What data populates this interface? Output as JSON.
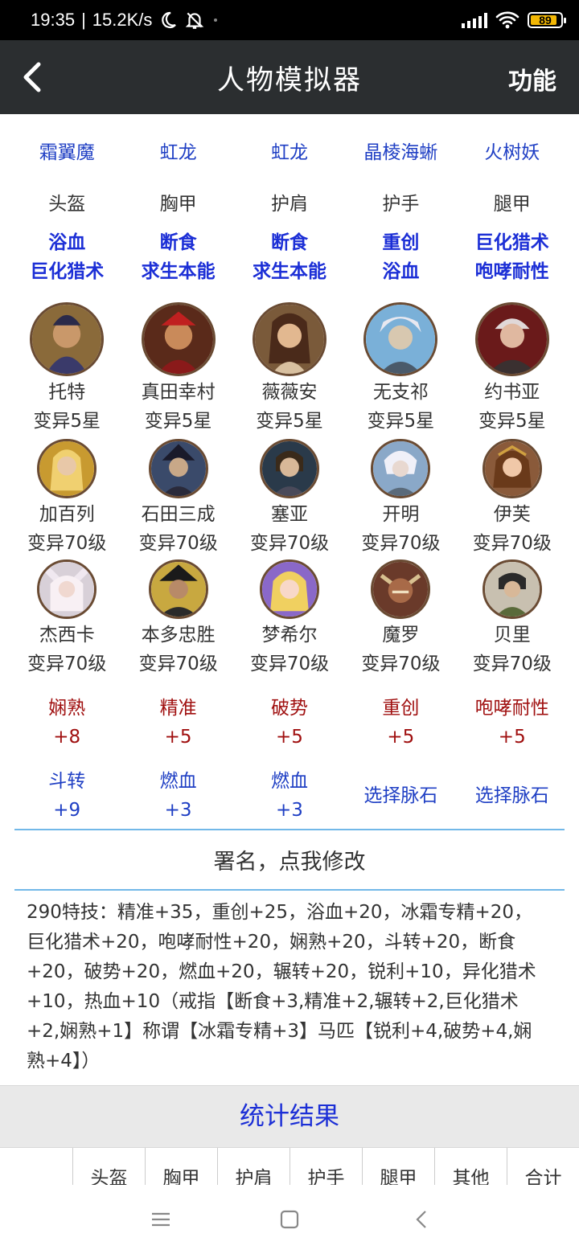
{
  "status_bar": {
    "time": "19:35",
    "separator": "|",
    "net_speed": "15.2K/s",
    "battery": "89",
    "battery_level": 0.89
  },
  "app_bar": {
    "title": "人物模拟器",
    "right_action": "功能"
  },
  "equipment": {
    "monsters": [
      "霜翼魔",
      "虹龙",
      "虹龙",
      "晶棱海蜥",
      "火树妖"
    ],
    "slots": [
      "头盔",
      "胸甲",
      "护肩",
      "护手",
      "腿甲"
    ],
    "skills": [
      [
        "浴血",
        "巨化猎术"
      ],
      [
        "断食",
        "求生本能"
      ],
      [
        "断食",
        "求生本能"
      ],
      [
        "重创",
        "浴血"
      ],
      [
        "巨化猎术",
        "咆哮耐性"
      ]
    ]
  },
  "heroes": [
    [
      {
        "name": "托特",
        "level": "变异5星"
      },
      {
        "name": "真田幸村",
        "level": "变异5星"
      },
      {
        "name": "薇薇安",
        "level": "变异5星"
      },
      {
        "name": "无支祁",
        "level": "变异5星"
      },
      {
        "name": "约书亚",
        "level": "变异5星"
      }
    ],
    [
      {
        "name": "加百列",
        "level": "变异70级"
      },
      {
        "name": "石田三成",
        "level": "变异70级"
      },
      {
        "name": "塞亚",
        "level": "变异70级"
      },
      {
        "name": "开明",
        "level": "变异70级"
      },
      {
        "name": "伊芙",
        "level": "变异70级"
      }
    ],
    [
      {
        "name": "杰西卡",
        "level": "变异70级"
      },
      {
        "name": "本多忠胜",
        "level": "变异70级"
      },
      {
        "name": "梦希尔",
        "level": "变异70级"
      },
      {
        "name": "魔罗",
        "level": "变异70级"
      },
      {
        "name": "贝里",
        "level": "变异70级"
      }
    ]
  ],
  "vein_stones": {
    "row1": [
      {
        "name": "娴熟",
        "value": "+8"
      },
      {
        "name": "精准",
        "value": "+5"
      },
      {
        "name": "破势",
        "value": "+5"
      },
      {
        "name": "重创",
        "value": "+5"
      },
      {
        "name": "咆哮耐性",
        "value": "+5"
      }
    ],
    "row2": [
      {
        "name": "斗转",
        "value": "+9"
      },
      {
        "name": "燃血",
        "value": "+3"
      },
      {
        "name": "燃血",
        "value": "+3"
      }
    ],
    "select_label": "选择脉石"
  },
  "signature": "署名，点我修改",
  "summary_lines": [
    "290特技：精准+35，重创+25，浴血+20，冰霜专精+20，",
    "巨化猎术+20，咆哮耐性+20，娴熟+20，斗转+20，断食",
    "+20，破势+20，燃血+20，辗转+20，锐利+10，异化猎术",
    "+10，热血+10（戒指【断食+3,精准+2,辗转+2,巨化猎术",
    "+2,娴熟+1】称谓【冰霜专精+3】马匹【锐利+4,破势+4,娴",
    "熟+4】）"
  ],
  "stats": {
    "title": "统计结果",
    "columns": [
      "",
      "头盔",
      "胸甲",
      "护肩",
      "护手",
      "腿甲",
      "其他",
      "合计"
    ]
  },
  "colors": {
    "app_bar": "#2b2e30",
    "blue_text": "#1f3fc4",
    "skill_blue": "#1c2fd6",
    "red_text": "#a01010",
    "divider": "#72b8e8"
  }
}
